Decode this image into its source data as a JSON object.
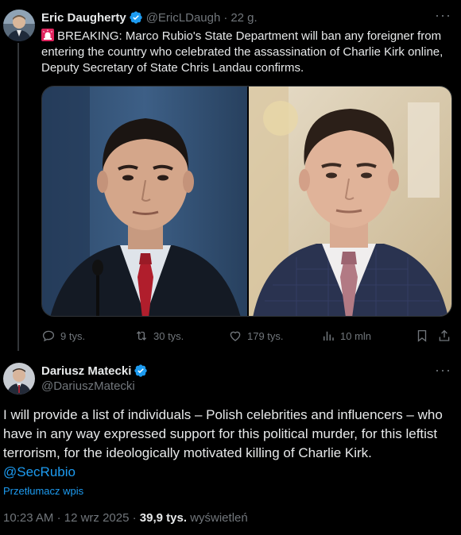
{
  "parent_tweet": {
    "author_name": "Eric Daugherty",
    "handle": "@EricLDaugh",
    "separator": "·",
    "time_ago": "22 g.",
    "text": "BREAKING: Marco Rubio's State Department will ban any foreigner from entering the country who celebrated the assassination of Charlie Kirk online, Deputy Secretary of State Chris Landau confirms.",
    "more_label": "···",
    "actions": {
      "replies": "9 tys.",
      "reposts": "30 tys.",
      "likes": "179 tys.",
      "views": "10 mln"
    }
  },
  "main_tweet": {
    "author_name": "Dariusz Matecki",
    "handle": "@DariuszMatecki",
    "more_label": "···",
    "text": "I will provide a list of individuals – Polish celebrities and influencers – who have in any way expressed support for this political murder, for this leftist terrorism, for the ideologically motivated killing of Charlie Kirk.",
    "mention": "@SecRubio",
    "translate_label": "Przetłumacz wpis",
    "time": "10:23 AM",
    "separator": "·",
    "date": "12 wrz 2025",
    "separator2": "·",
    "views_count": "39,9 tys.",
    "views_label": "wyświetleń"
  },
  "colors": {
    "background": "#000000",
    "text": "#e7e9ea",
    "muted": "#71767b",
    "accent": "#1d9bf0",
    "border": "#2f3336"
  },
  "icons": [
    "verified-badge-icon",
    "siren-icon",
    "reply-icon",
    "repost-icon",
    "like-icon",
    "views-icon",
    "bookmark-icon",
    "share-icon",
    "more-icon"
  ]
}
